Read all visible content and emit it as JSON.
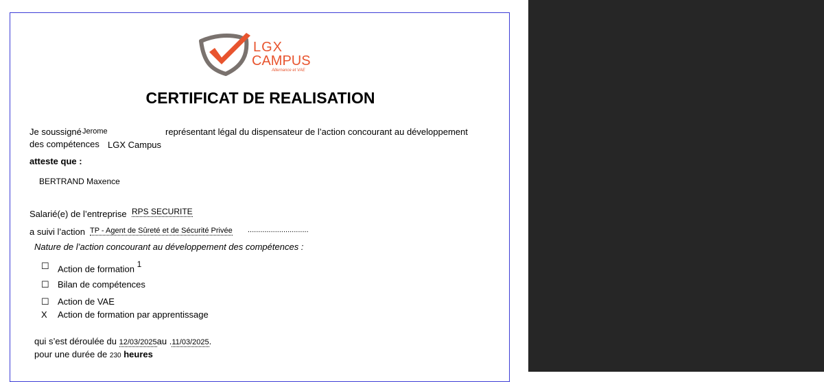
{
  "logo": {
    "brand_line1": "LGX",
    "brand_line2": "CAMPUS",
    "tagline": "Alternance et VAE",
    "colors": {
      "shield": "#7a726e",
      "check": "#e8542e",
      "text": "#e8542e"
    }
  },
  "title": "CERTIFICAT DE REALISATION",
  "intro": {
    "prefix": "Je soussigné",
    "signatory": "Jerome",
    "middle": "représentant légal du dispensateur de l’action concourant au développement",
    "line2_prefix": "des compétences",
    "organization": "LGX Campus"
  },
  "attest_label": "atteste que :",
  "learner_name": "BERTRAND Maxence",
  "employer": {
    "label": "Salarié(e) de l’entreprise",
    "value": "RPS  SECURITE"
  },
  "action": {
    "label": "a suivi l’action",
    "value": "TP - Agent de Sûreté et de Sécurité Privée",
    "trailing_dots": "............................."
  },
  "nature_heading": "Nature de l’action concourant au développement des compétences :",
  "options": [
    {
      "mark": "☐",
      "label": "Action de formation",
      "sup": "1"
    },
    {
      "mark": "☐",
      "label": "Bilan de compétences",
      "sup": ""
    },
    {
      "mark": "☐",
      "label": "Action de VAE",
      "sup": ""
    },
    {
      "mark": "X",
      "label": "Action de formation par apprentissage",
      "sup": ""
    }
  ],
  "dates": {
    "prefix": "qui s’est déroulée du",
    "start": "12/03/2025",
    "mid": "au",
    "end_prefix": " .",
    "end": "11/03/2025",
    "end_suffix": "."
  },
  "duration": {
    "prefix": "pour une durée de",
    "value": "230",
    "unit": "heures"
  }
}
